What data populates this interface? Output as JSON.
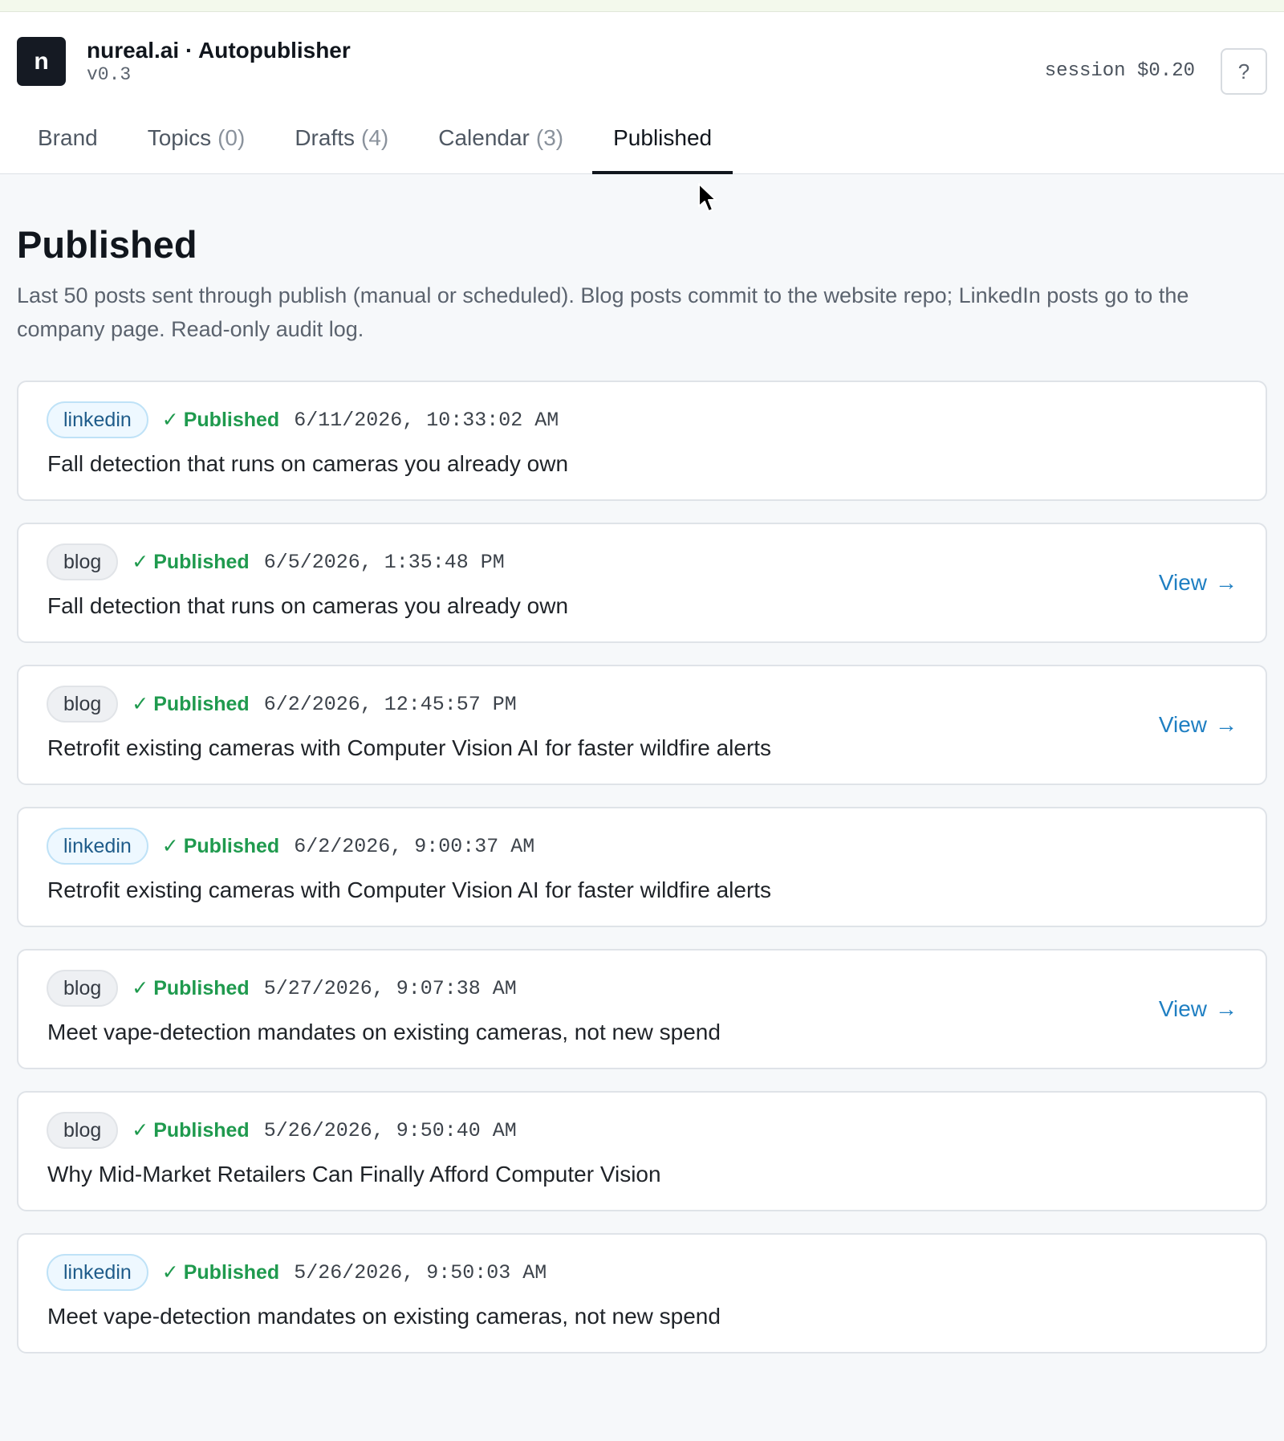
{
  "app": {
    "logo_letter": "n",
    "title": "nureal.ai · Autopublisher",
    "version": "v0.3",
    "session": "session $0.20",
    "help_label": "?"
  },
  "tabs": [
    {
      "label": "Brand",
      "count": ""
    },
    {
      "label": "Topics",
      "count": "(0)"
    },
    {
      "label": "Drafts",
      "count": "(4)"
    },
    {
      "label": "Calendar",
      "count": "(3)"
    },
    {
      "label": "Published",
      "count": "",
      "active": true
    }
  ],
  "page": {
    "title": "Published",
    "description": "Last 50 posts sent through publish (manual or scheduled). Blog posts commit to the website repo; LinkedIn posts go to the company page. Read-only audit log."
  },
  "posts": [
    {
      "channel": "linkedin",
      "status": "Published",
      "timestamp": "6/11/2026, 10:33:02 AM",
      "title": "Fall detection that runs on cameras you already own",
      "view": ""
    },
    {
      "channel": "blog",
      "status": "Published",
      "timestamp": "6/5/2026, 1:35:48 PM",
      "title": "Fall detection that runs on cameras you already own",
      "view": "View"
    },
    {
      "channel": "blog",
      "status": "Published",
      "timestamp": "6/2/2026, 12:45:57 PM",
      "title": "Retrofit existing cameras with Computer Vision AI for faster wildfire alerts",
      "view": "View"
    },
    {
      "channel": "linkedin",
      "status": "Published",
      "timestamp": "6/2/2026, 9:00:37 AM",
      "title": "Retrofit existing cameras with Computer Vision AI for faster wildfire alerts",
      "view": ""
    },
    {
      "channel": "blog",
      "status": "Published",
      "timestamp": "5/27/2026, 9:07:38 AM",
      "title": "Meet vape-detection mandates on existing cameras, not new spend",
      "view": "View"
    },
    {
      "channel": "blog",
      "status": "Published",
      "timestamp": "5/26/2026, 9:50:40 AM",
      "title": "Why Mid-Market Retailers Can Finally Afford Computer Vision",
      "view": ""
    },
    {
      "channel": "linkedin",
      "status": "Published",
      "timestamp": "5/26/2026, 9:50:03 AM",
      "title": "Meet vape-detection mandates on existing cameras, not new spend",
      "view": ""
    }
  ],
  "icons": {
    "check": "✓",
    "arrow": "→"
  },
  "colors": {
    "accent_link": "#1f7fc2",
    "status_green": "#1f9a4e",
    "logo_bg": "#151a23"
  }
}
